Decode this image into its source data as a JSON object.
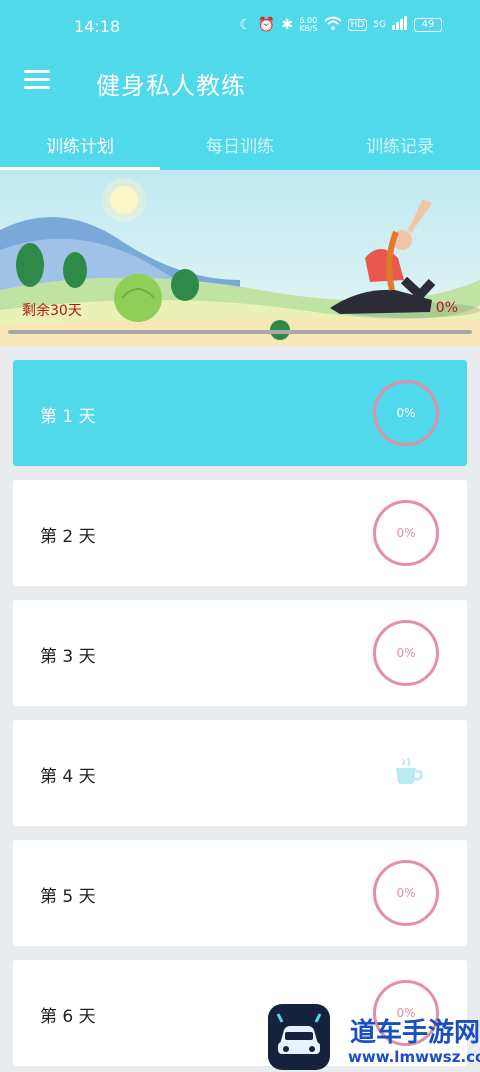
{
  "status_bar": {
    "time": "14:18",
    "net_speed_value": "6.00",
    "net_speed_unit": "KB/S",
    "hd_badge": "HD",
    "signal": "5G",
    "battery": "49",
    "icons": [
      "moon-icon",
      "alarm-icon",
      "bluetooth-icon",
      "wifi-icon",
      "signal-icon",
      "battery-icon"
    ]
  },
  "appbar": {
    "title": "健身私人教练"
  },
  "tabs": [
    {
      "label": "训练计划",
      "active": true
    },
    {
      "label": "每日训练",
      "active": false
    },
    {
      "label": "训练记录",
      "active": false
    }
  ],
  "banner": {
    "remaining": "剩余30天",
    "progress_label": "0%",
    "progress_fraction": 0
  },
  "days": [
    {
      "label": "第 1 天",
      "progress": "0%",
      "rest": false,
      "active": true
    },
    {
      "label": "第 2 天",
      "progress": "0%",
      "rest": false,
      "active": false
    },
    {
      "label": "第 3 天",
      "progress": "0%",
      "rest": false,
      "active": false
    },
    {
      "label": "第 4 天",
      "progress": "",
      "rest": true,
      "active": false
    },
    {
      "label": "第 5 天",
      "progress": "0%",
      "rest": false,
      "active": false
    },
    {
      "label": "第 6 天",
      "progress": "0%",
      "rest": false,
      "active": false
    }
  ],
  "watermark": {
    "name": "道车手游网",
    "url": "www.lmwwsz.com"
  },
  "colors": {
    "primary": "#4fd9ea",
    "ring": "#e38fa6",
    "remain_text": "#b01818"
  }
}
